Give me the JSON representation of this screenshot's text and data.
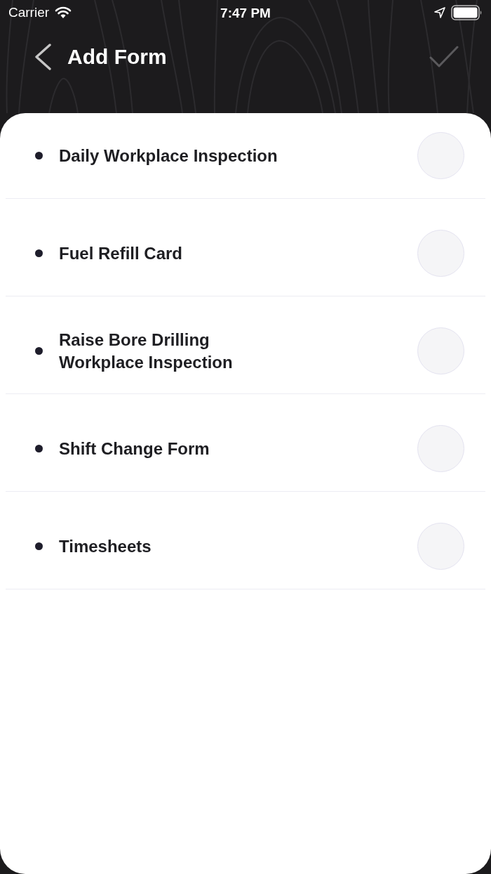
{
  "status_bar": {
    "carrier": "Carrier",
    "time": "7:47 PM"
  },
  "nav_bar": {
    "title": "Add Form",
    "done_button": {
      "disabled": true
    }
  },
  "forms": [
    {
      "label": "Daily Workplace Inspection",
      "selected": false
    },
    {
      "label": "Fuel Refill Card",
      "selected": false
    },
    {
      "label": "Raise Bore Drilling Workplace Inspection",
      "selected": false
    },
    {
      "label": "Shift Change Form",
      "selected": false
    },
    {
      "label": "Timesheets",
      "selected": false
    }
  ]
}
